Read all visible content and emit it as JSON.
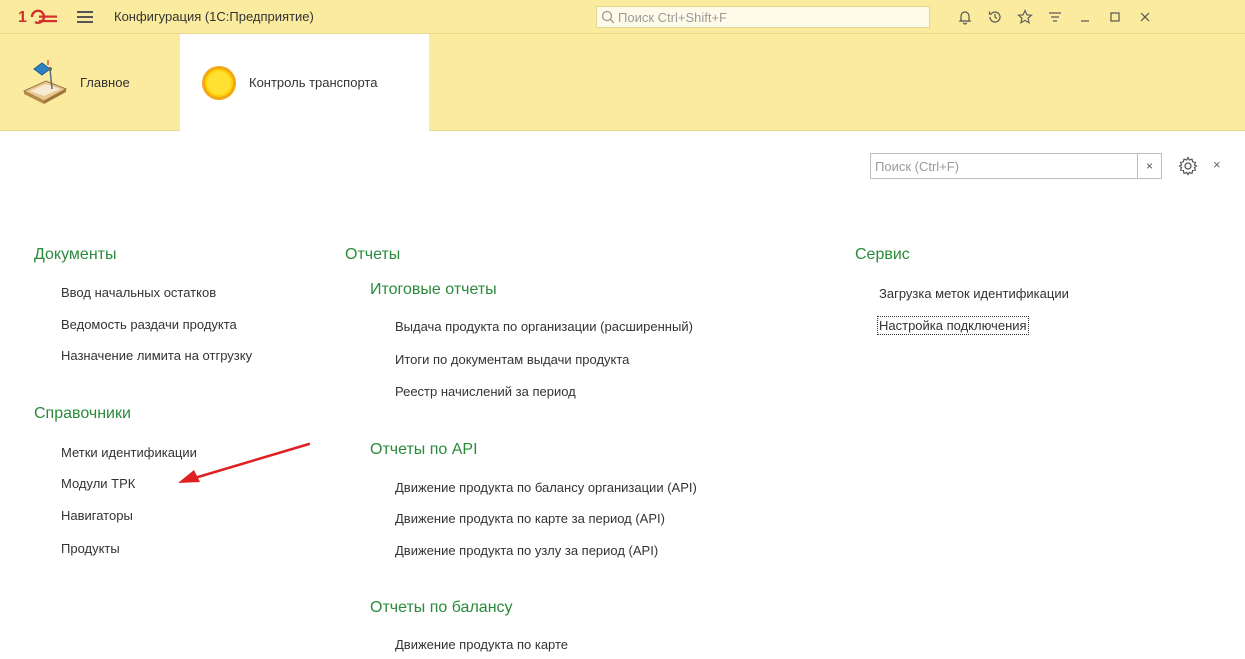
{
  "titlebar": {
    "title": "Конфигурация  (1С:Предприятие)",
    "search_placeholder": "Поиск Ctrl+Shift+F",
    "icons": [
      "bell-icon",
      "history-icon",
      "star-icon",
      "menu-more-icon",
      "minimize-icon",
      "maximize-icon",
      "close-icon"
    ],
    "icon_glyphs": [
      "∆",
      "↺",
      "☆",
      "≡",
      "_",
      "□",
      "×"
    ]
  },
  "sections": [
    {
      "label": "Главное",
      "icon": "desk-lamp-icon"
    },
    {
      "label": "Контроль транспорта",
      "icon": "yellow-circle-icon"
    }
  ],
  "local_search": {
    "placeholder": "Поиск (Ctrl+F)",
    "clear_glyph": "×",
    "close_glyph": "×"
  },
  "documents": {
    "title": "Документы",
    "items": [
      "Ввод начальных остатков",
      "Ведомость раздачи продукта",
      "Назначение лимита на отгрузку"
    ]
  },
  "catalogs": {
    "title": "Справочники",
    "items": [
      "Метки идентификации",
      "Модули ТРК",
      "Навигаторы",
      "Продукты"
    ]
  },
  "reports": {
    "title": "Отчеты",
    "summary": {
      "title": "Итоговые отчеты",
      "items": [
        "Выдача продукта по организации (расширенный)",
        "Итоги по документам выдачи продукта",
        "Реестр начислений за период"
      ]
    },
    "api": {
      "title": "Отчеты по API",
      "items": [
        "Движение продукта по балансу организации (API)",
        "Движение продукта по карте за период (API)",
        "Движение продукта по узлу за период (API)"
      ]
    },
    "balance": {
      "title": "Отчеты по балансу",
      "items": [
        "Движение продукта по карте"
      ]
    }
  },
  "service": {
    "title": "Сервис",
    "items": [
      "Загрузка меток идентификации",
      "Настройка подключения"
    ]
  },
  "colors": {
    "header_bg": "#fbeb9f",
    "group_title": "#2a8a3b",
    "arrow": "#e02020"
  }
}
